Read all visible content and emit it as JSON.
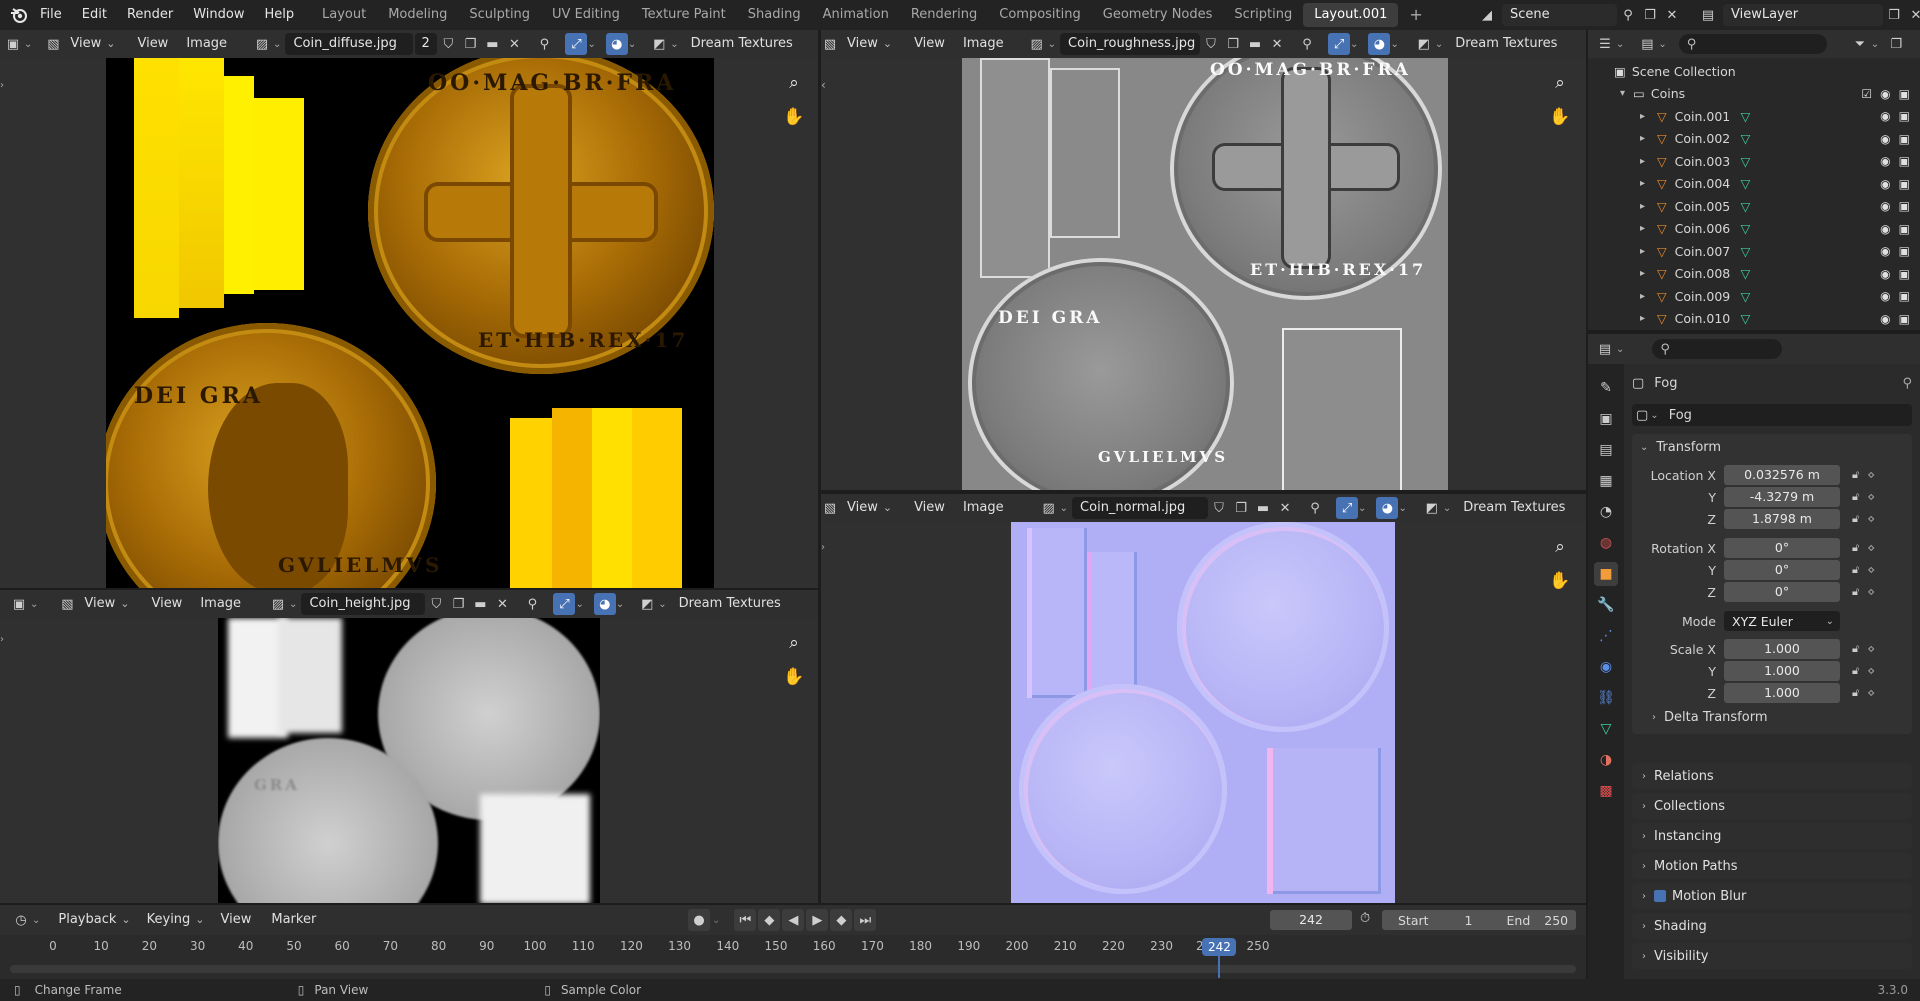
{
  "topbar": {
    "menus": [
      "File",
      "Edit",
      "Render",
      "Window",
      "Help"
    ],
    "workspaces": [
      "Layout",
      "Modeling",
      "Sculpting",
      "UV Editing",
      "Texture Paint",
      "Shading",
      "Animation",
      "Rendering",
      "Compositing",
      "Geometry Nodes",
      "Scripting",
      "Layout.001"
    ],
    "active_workspace": "Layout.001",
    "add_tab": "+",
    "scene": "Scene",
    "view_layer": "ViewLayer"
  },
  "editors": {
    "diffuse": {
      "view_menu": "View",
      "menu_view": "View",
      "menu_image": "Image",
      "image": "Coin_diffuse.jpg",
      "users": "2",
      "dream": "Dream Textures",
      "coin_top_text": "OO·MAG·BR·FRA",
      "coin_top_text2": "ET·HIB·REX·17",
      "coin_bottom_text": "GVLIELMVS",
      "coin_bottom_text2": "DEI GRA"
    },
    "roughness": {
      "view_menu": "View",
      "menu_view": "View",
      "menu_image": "Image",
      "image": "Coin_roughness.jpg",
      "dream": "Dream Textures",
      "coin_top_text": "OO·MAG·BR·FRA",
      "coin_top_text2": "ET·HIB·REX·17",
      "coin_bottom_text": "GVLIELMVS",
      "coin_bottom_text2": "DEI GRA"
    },
    "height": {
      "view_menu": "View",
      "menu_view": "View",
      "menu_image": "Image",
      "image": "Coin_height.jpg",
      "dream": "Dream Textures",
      "coin_text": "GRA"
    },
    "normal": {
      "view_menu": "View",
      "menu_view": "View",
      "menu_image": "Image",
      "image": "Coin_normal.jpg",
      "dream": "Dream Textures"
    }
  },
  "outliner": {
    "root": "Scene Collection",
    "collection": "Coins",
    "items": [
      "Coin.001",
      "Coin.002",
      "Coin.003",
      "Coin.004",
      "Coin.005",
      "Coin.006",
      "Coin.007",
      "Coin.008",
      "Coin.009",
      "Coin.010"
    ]
  },
  "properties": {
    "object_name": "Fog",
    "data_name": "Fog",
    "transform": {
      "title": "Transform",
      "location_label": "Location X",
      "location": [
        "0.032576 m",
        "-4.3279 m",
        "1.8798 m"
      ],
      "rotation_label": "Rotation X",
      "rotation": [
        "0°",
        "0°",
        "0°"
      ],
      "mode_label": "Mode",
      "mode": "XYZ Euler",
      "scale_label": "Scale X",
      "scale": [
        "1.000",
        "1.000",
        "1.000"
      ],
      "y_label": "Y",
      "z_label": "Z"
    },
    "delta": "Delta Transform",
    "panels": [
      "Relations",
      "Collections",
      "Instancing",
      "Motion Paths",
      "Motion Blur",
      "Shading",
      "Visibility"
    ]
  },
  "timeline": {
    "menus": [
      "Playback",
      "Keying",
      "View",
      "Marker"
    ],
    "current_frame": "242",
    "start_label": "Start",
    "start": "1",
    "end_label": "End",
    "end": "250",
    "ticks": [
      "0",
      "10",
      "20",
      "30",
      "40",
      "50",
      "60",
      "70",
      "80",
      "90",
      "100",
      "110",
      "120",
      "130",
      "140",
      "150",
      "160",
      "170",
      "180",
      "190",
      "200",
      "210",
      "220",
      "230",
      "2",
      "242",
      "250"
    ],
    "playhead": 242
  },
  "statusbar": {
    "hint1": "Change Frame",
    "hint2": "Pan View",
    "hint3": "Sample Color",
    "version": "3.3.0"
  },
  "colors": {
    "accent": "#4772b3",
    "mesh_orange": "#e8892a",
    "mesh_data_green": "#3ccf9a",
    "gold": "#d9a11f",
    "normal_bg": "#8080ff"
  }
}
